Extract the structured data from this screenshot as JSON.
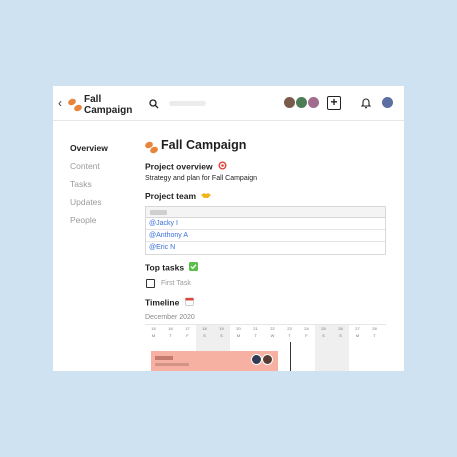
{
  "header": {
    "back_glyph": "‹",
    "app_title": "Fall Campaign",
    "avatar_colors": [
      "#7a5b4b",
      "#4c7d55",
      "#a26c8e"
    ],
    "add_glyph": "+",
    "current_user_avatar_color": "#5b6fa3"
  },
  "sidebar": {
    "items": [
      {
        "label": "Overview",
        "active": true
      },
      {
        "label": "Content",
        "active": false
      },
      {
        "label": "Tasks",
        "active": false
      },
      {
        "label": "Updates",
        "active": false
      },
      {
        "label": "People",
        "active": false
      }
    ]
  },
  "page": {
    "title": "Fall Campaign",
    "overview_heading": "Project overview",
    "overview_icon": "target-icon",
    "overview_text": "Strategy and plan for Fall Campaign",
    "team_heading": "Project team",
    "team_icon": "handshake-icon",
    "team_members": [
      "@Jacky I",
      "@Anthony A",
      "@Eric N"
    ],
    "tasks_heading": "Top tasks",
    "tasks_icon": "check-icon",
    "tasks": [
      {
        "label": "First Task",
        "done": false
      }
    ],
    "timeline_heading": "Timeline",
    "timeline_icon": "calendar-icon",
    "timeline_month": "December 2020",
    "timeline_days": [
      {
        "num": "15",
        "wd": "M"
      },
      {
        "num": "16",
        "wd": "T"
      },
      {
        "num": "17",
        "wd": "F"
      },
      {
        "num": "18",
        "wd": "S"
      },
      {
        "num": "19",
        "wd": "S"
      },
      {
        "num": "20",
        "wd": "M"
      },
      {
        "num": "21",
        "wd": "T"
      },
      {
        "num": "22",
        "wd": "W"
      },
      {
        "num": "23",
        "wd": "T"
      },
      {
        "num": "24",
        "wd": "F"
      },
      {
        "num": "25",
        "wd": "S"
      },
      {
        "num": "26",
        "wd": "S"
      },
      {
        "num": "27",
        "wd": "M"
      },
      {
        "num": "28",
        "wd": "T"
      }
    ],
    "weekend_indices": [
      3,
      4,
      10,
      11
    ],
    "bar_color": "#f6b1a2"
  }
}
